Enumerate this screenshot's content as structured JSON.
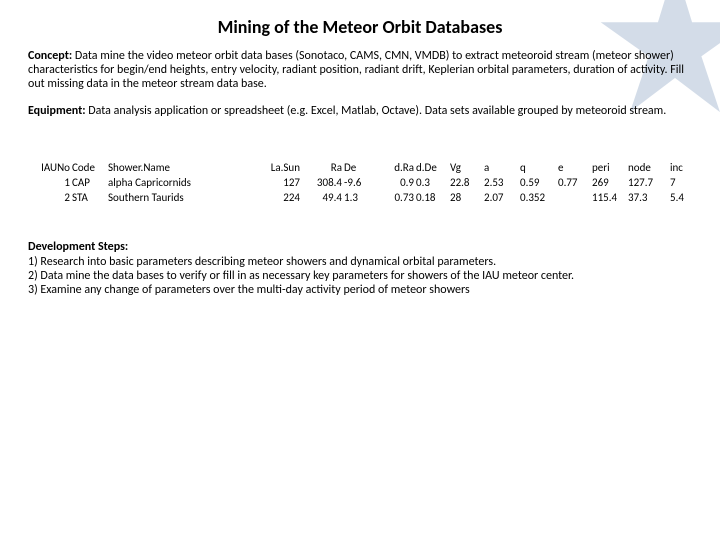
{
  "title": "Mining of the Meteor Orbit Databases",
  "concept_label": "Concept:",
  "concept_text": "  Data mine the video meteor orbit data bases (Sonotaco, CAMS, CMN, VMDB) to extract meteoroid stream (meteor shower) characteristics for begin/end heights, entry velocity, radiant position, radiant drift, Keplerian orbital parameters, duration of activity.  Fill out missing data in the meteor stream data base.",
  "equipment_label": "Equipment:",
  "equipment_text": " Data analysis application or spreadsheet (e.g. Excel, Matlab, Octave). Data sets available grouped by meteoroid stream.",
  "table": {
    "headers": [
      "IAUNo",
      "Code",
      "Shower.Name",
      "La.Sun",
      "Ra",
      "De",
      "d.Ra",
      "d.De",
      "Vg",
      "a",
      "q",
      "e",
      "peri",
      "node",
      "inc"
    ],
    "rows": [
      [
        "1",
        "CAP",
        "alpha Capricornids",
        "127",
        "308.4",
        "-9.6",
        "0.9",
        "0.3",
        "22.8",
        "2.53",
        "0.59",
        "0.77",
        "269",
        "127.7",
        "7"
      ],
      [
        "2",
        "STA",
        "Southern Taurids",
        "224",
        "49.4",
        "1.3",
        "0.73",
        "0.18",
        "28",
        "2.07",
        "0.352",
        "",
        "115.4",
        "37.3",
        "5.4"
      ]
    ]
  },
  "dev": {
    "heading": "Development Steps:",
    "steps": [
      "1)  Research into basic parameters describing meteor showers and dynamical orbital parameters.",
      "2)  Data mine the data bases to verify or fill in as necessary key parameters for showers of the IAU meteor center.",
      "3)  Examine any change of parameters over the multi-day activity period of meteor showers"
    ]
  },
  "chart_data": {
    "type": "table",
    "title": "Meteoroid stream sample rows",
    "columns": [
      "IAUNo",
      "Code",
      "Shower.Name",
      "La.Sun",
      "Ra",
      "De",
      "d.Ra",
      "d.De",
      "Vg",
      "a",
      "q",
      "e",
      "peri",
      "node",
      "inc"
    ],
    "rows": [
      {
        "IAUNo": 1,
        "Code": "CAP",
        "Shower.Name": "alpha Capricornids",
        "La.Sun": 127,
        "Ra": 308.4,
        "De": -9.6,
        "d.Ra": 0.9,
        "d.De": 0.3,
        "Vg": 22.8,
        "a": 2.53,
        "q": 0.59,
        "e": 0.77,
        "peri": 269,
        "node": 127.7,
        "inc": 7
      },
      {
        "IAUNo": 2,
        "Code": "STA",
        "Shower.Name": "Southern Taurids",
        "La.Sun": 224,
        "Ra": 49.4,
        "De": 1.3,
        "d.Ra": 0.73,
        "d.De": 0.18,
        "Vg": 28,
        "a": 2.07,
        "q": 0.352,
        "e": null,
        "peri": 115.4,
        "node": 37.3,
        "inc": 5.4
      }
    ]
  }
}
